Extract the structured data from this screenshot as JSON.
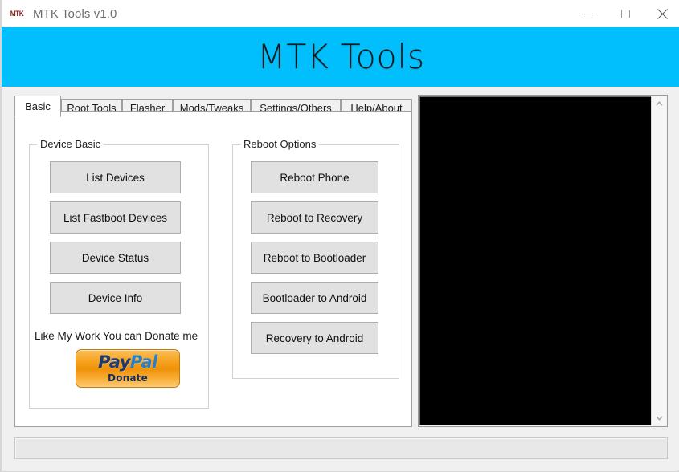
{
  "window": {
    "title": "MTK Tools v1.0",
    "icon_label": "MTK",
    "icon_name": "mtk-app-icon",
    "controls": {
      "minimize": "minimize-icon",
      "maximize": "maximize-icon",
      "close": "close-icon"
    }
  },
  "banner": {
    "title": "MTK Tools",
    "background_color": "#00BFFC"
  },
  "tabs": [
    {
      "label": "Basic",
      "active": true
    },
    {
      "label": "Root Tools",
      "active": false
    },
    {
      "label": "Flasher",
      "active": false
    },
    {
      "label": "Mods/Tweaks",
      "active": false
    },
    {
      "label": "Settings/Others",
      "active": false
    },
    {
      "label": "Help/About",
      "active": false
    }
  ],
  "device_basic": {
    "title": "Device Basic",
    "buttons": [
      {
        "label": "List Devices"
      },
      {
        "label": "List Fastboot Devices"
      },
      {
        "label": "Device Status"
      },
      {
        "label": "Device Info"
      }
    ]
  },
  "reboot_options": {
    "title": "Reboot Options",
    "buttons": [
      {
        "label": "Reboot Phone"
      },
      {
        "label": "Reboot to Recovery"
      },
      {
        "label": "Reboot to Bootloader"
      },
      {
        "label": "Bootloader to Android"
      },
      {
        "label": "Recovery to Android"
      }
    ]
  },
  "donate": {
    "text": "Like My Work You can Donate me",
    "paypal": {
      "pay": "Pay",
      "pal": "Pal",
      "donate": "Donate",
      "background_color": "#F09207"
    }
  },
  "console": {
    "text": "",
    "background_color": "#000000",
    "scroll_up": "chevron-up-icon",
    "scroll_down": "chevron-down-icon"
  },
  "statusbar": {
    "text": ""
  }
}
